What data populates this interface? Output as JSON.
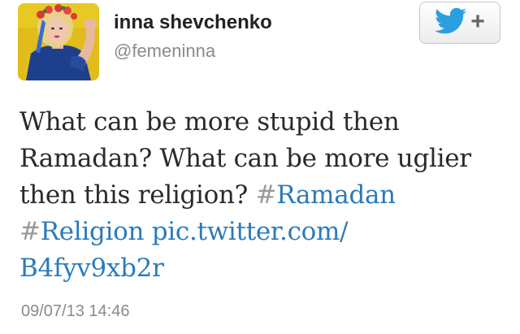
{
  "user": {
    "name": "inna shevchenko",
    "handle": "@femeninna"
  },
  "follow_button": {
    "icon": "twitter-bird-icon",
    "plus_label": "+",
    "bird_color": "#2b9fe0"
  },
  "tweet": {
    "line1": "What can be more stupid then",
    "line2": "Ramadan? What can be more uglier",
    "line3_text": "then this religion? ",
    "hashtag1_symbol": "#",
    "hashtag1": "Ramadan",
    "hashtag2_symbol": "#",
    "hashtag2": "Religion",
    "link_part1": "pic.twitter.com/",
    "link_part2": "B4fyv9xb2r",
    "link_color": "#2b7bb9"
  },
  "timestamp": "09/07/13 14:46"
}
